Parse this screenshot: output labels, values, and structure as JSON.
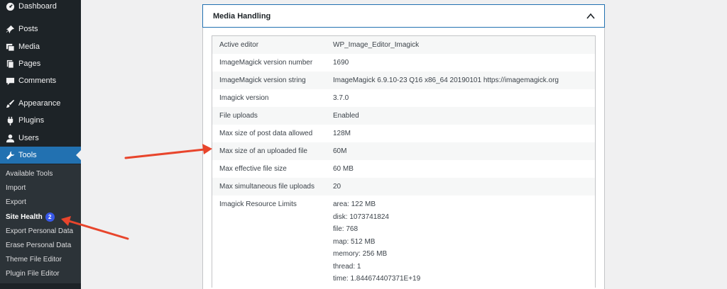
{
  "sidebar": {
    "items": [
      {
        "label": "Dashboard",
        "icon": "dashboard-icon"
      },
      {
        "label": "Posts",
        "icon": "pushpin-icon"
      },
      {
        "label": "Media",
        "icon": "media-icon"
      },
      {
        "label": "Pages",
        "icon": "pages-icon"
      },
      {
        "label": "Comments",
        "icon": "comment-icon"
      },
      {
        "label": "Appearance",
        "icon": "paintbrush-icon"
      },
      {
        "label": "Plugins",
        "icon": "plugin-icon"
      },
      {
        "label": "Users",
        "icon": "user-icon"
      },
      {
        "label": "Tools",
        "icon": "wrench-icon"
      }
    ],
    "submenu": [
      {
        "label": "Available Tools"
      },
      {
        "label": "Import"
      },
      {
        "label": "Export"
      },
      {
        "label": "Site Health",
        "badge": "2"
      },
      {
        "label": "Export Personal Data"
      },
      {
        "label": "Erase Personal Data"
      },
      {
        "label": "Theme File Editor"
      },
      {
        "label": "Plugin File Editor"
      }
    ]
  },
  "accordion": {
    "title": "Media Handling"
  },
  "rows": [
    {
      "label": "Active editor",
      "value": "WP_Image_Editor_Imagick"
    },
    {
      "label": "ImageMagick version number",
      "value": "1690"
    },
    {
      "label": "ImageMagick version string",
      "value": "ImageMagick 6.9.10-23 Q16 x86_64 20190101 https://imagemagick.org"
    },
    {
      "label": "Imagick version",
      "value": "3.7.0"
    },
    {
      "label": "File uploads",
      "value": "Enabled"
    },
    {
      "label": "Max size of post data allowed",
      "value": "128M"
    },
    {
      "label": "Max size of an uploaded file",
      "value": "60M"
    },
    {
      "label": "Max effective file size",
      "value": "60 MB"
    },
    {
      "label": "Max simultaneous file uploads",
      "value": "20"
    }
  ],
  "limits": {
    "label": "Imagick Resource Limits",
    "values": [
      "area: 122 MB",
      "disk: 1073741824",
      "file: 768",
      "map: 512 MB",
      "memory: 256 MB",
      "thread: 1",
      "time: 1.844674407371E+19"
    ]
  },
  "colors": {
    "sidebar_bg": "#1d2327",
    "submenu_bg": "#2c3338",
    "accent": "#2271b1",
    "badge": "#3858e9",
    "annotation_arrow": "#e8452c"
  }
}
